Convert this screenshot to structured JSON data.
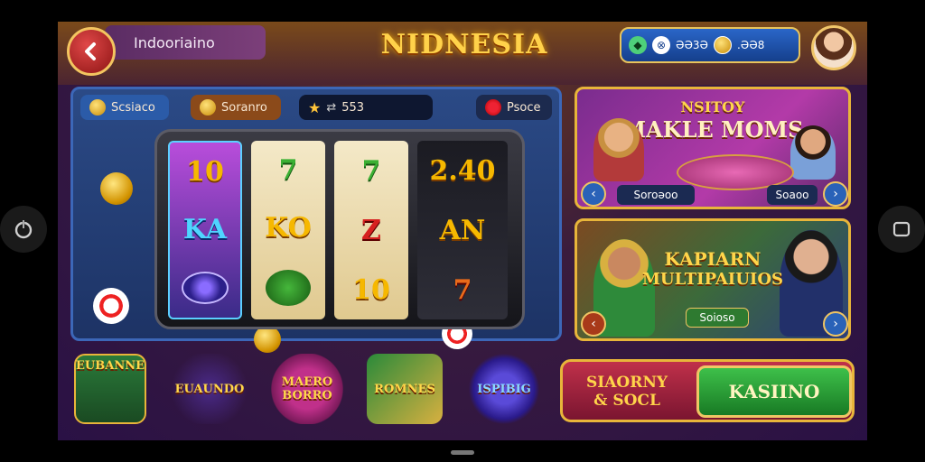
{
  "header": {
    "title_pill": "Indooriaino",
    "game_title": "NIDNESIA",
    "status": {
      "value1": "ƏƏ3Ə",
      "value2": ".ƏƏ8"
    }
  },
  "slot": {
    "pill_left": "Scsiaco",
    "pill_mid": "Soranro",
    "balance": "553",
    "pill_right": "Psoce",
    "reel1": [
      "10",
      "KA"
    ],
    "reel2": [
      "7",
      "KO"
    ],
    "reel3": [
      "7",
      "Z",
      "10"
    ],
    "reel4": [
      "2.40",
      "AN",
      "7"
    ]
  },
  "cards": {
    "card1": {
      "title_line1": "NSITOY",
      "title_line2": "MAKLE MOMS",
      "button": "Soroəoo",
      "button2": "Soaoo"
    },
    "card2": {
      "title_line1": "KAPIARN",
      "title_line2": "MULTIPAIUIOS",
      "button": "Soioso"
    }
  },
  "bottom": {
    "games": [
      "EUBANNE",
      "EUAUNDO",
      "MAERO BORRO",
      "ROMNES",
      "ISPIBIG"
    ],
    "social_line1": "SIAORNY",
    "social_line2": "& SOCL",
    "kasino": "KASIINO"
  },
  "colors": {
    "accent_gold": "#e8b53a",
    "primary_blue": "#2a62b8",
    "action_green": "#3ec04a",
    "action_red": "#c0304a"
  },
  "icons": [
    "power-icon",
    "back-arrow-icon",
    "square-icon",
    "coin-icon",
    "spade-icon"
  ]
}
